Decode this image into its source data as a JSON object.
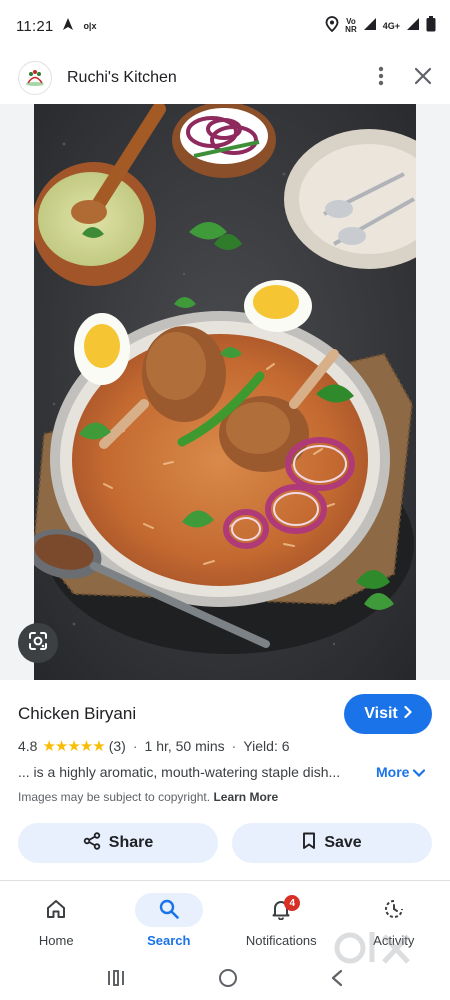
{
  "status_bar": {
    "time": "11:21",
    "carrier_mark": "o|x",
    "volte_line1": "Vo",
    "volte_line2": "NR",
    "network": "4G+",
    "icons": [
      "navigation-icon",
      "location-icon",
      "signal-icon",
      "battery-icon"
    ]
  },
  "header": {
    "site_name": "Ruchi's Kitchen",
    "icons": [
      "site-logo",
      "more-vert-icon",
      "close-icon"
    ]
  },
  "image": {
    "alt": "Chicken Biryani",
    "lens_icon": "lens-icon"
  },
  "recipe": {
    "title": "Chicken Biryani",
    "visit_label": "Visit",
    "rating": "4.8",
    "stars": "★★★★★",
    "rating_value": 4.8,
    "review_count": "(3)",
    "duration": "1 hr, 50 mins",
    "yield": "Yield: 6",
    "description": "... is a highly aromatic, mouth-watering staple dish...",
    "more_label": "More",
    "copyright_text": "Images may be subject to copyright.",
    "learn_more_label": "Learn More"
  },
  "actions": {
    "share_label": "Share",
    "save_label": "Save"
  },
  "bottom_nav": {
    "items": [
      {
        "label": "Home",
        "icon": "home-icon"
      },
      {
        "label": "Search",
        "icon": "search-icon",
        "active": true
      },
      {
        "label": "Notifications",
        "icon": "bell-icon",
        "badge": "4"
      },
      {
        "label": "Activity",
        "icon": "activity-icon"
      }
    ]
  },
  "watermark_text": "OLX",
  "colors": {
    "accent": "#1a73e8",
    "pill_bg": "#e8f0fe",
    "star": "#fbbc04",
    "badge": "#d93025"
  }
}
